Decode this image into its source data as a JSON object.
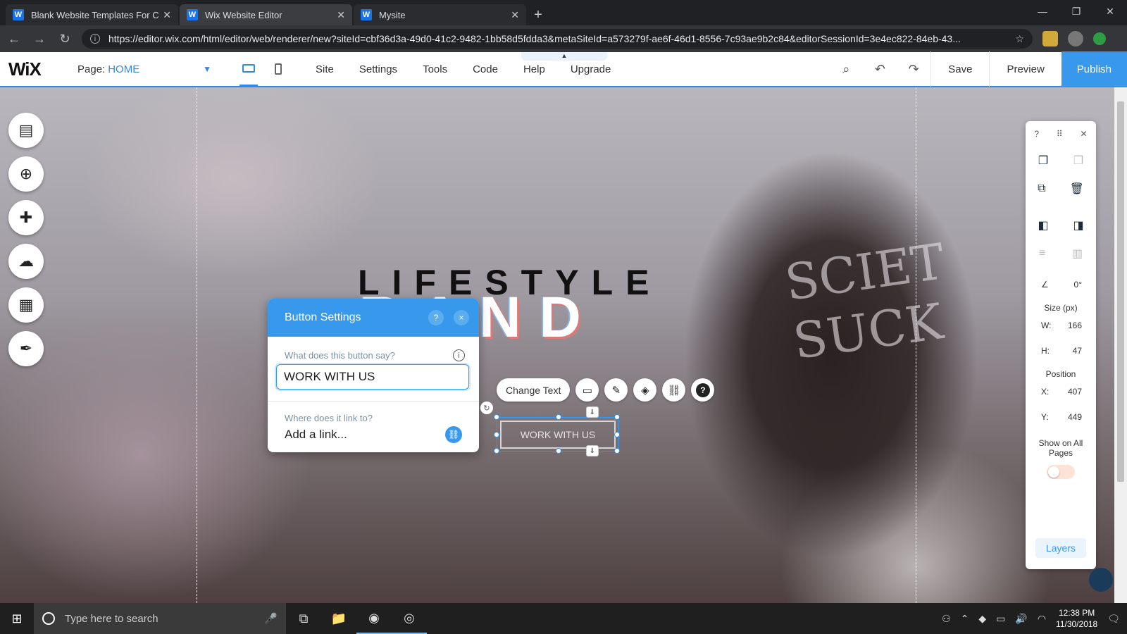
{
  "browser": {
    "tabs": [
      {
        "label": "Blank Website Templates For Cre",
        "active": false
      },
      {
        "label": "Wix Website Editor",
        "active": true
      },
      {
        "label": "Mysite",
        "active": false
      }
    ],
    "url": "https://editor.wix.com/html/editor/web/renderer/new?siteId=cbf36d3a-49d0-41c2-9482-1bb58d5fdda3&metaSiteId=a573279f-ae6f-46d1-8556-7c93ae9b2c84&editorSessionId=3e4ec822-84eb-43..."
  },
  "editor": {
    "logo": "WiX",
    "page_prefix": "Page:",
    "page_name": "HOME",
    "menu": [
      "Site",
      "Settings",
      "Tools",
      "Code",
      "Help",
      "Upgrade"
    ],
    "save": "Save",
    "preview": "Preview",
    "publish": "Publish"
  },
  "canvas": {
    "headline_top": "LIFESTYLE",
    "headline_bottom": "RAND",
    "graffiti": "SCIET\nSUCK"
  },
  "button_settings": {
    "title": "Button Settings",
    "help": "?",
    "close": "×",
    "text_question": "What does this button say?",
    "text_value": "WORK WITH US",
    "link_question": "Where does it link to?",
    "link_value": "Add a link..."
  },
  "toolbar": {
    "change_text": "Change Text"
  },
  "selected_button": {
    "label": "WORK WITH US"
  },
  "inspector": {
    "rotation": "0°",
    "size_label": "Size (px)",
    "w_label": "W:",
    "w_value": "166",
    "h_label": "H:",
    "h_value": "47",
    "position_label": "Position",
    "x_label": "X:",
    "x_value": "407",
    "y_label": "Y:",
    "y_value": "449",
    "show_all_pages": "Show on All Pages",
    "layers": "Layers"
  },
  "taskbar": {
    "search_placeholder": "Type here to search",
    "time": "12:38 PM",
    "date": "11/30/2018"
  },
  "colors": {
    "wix_blue": "#3899ec",
    "publish_bg": "#3899ec"
  }
}
